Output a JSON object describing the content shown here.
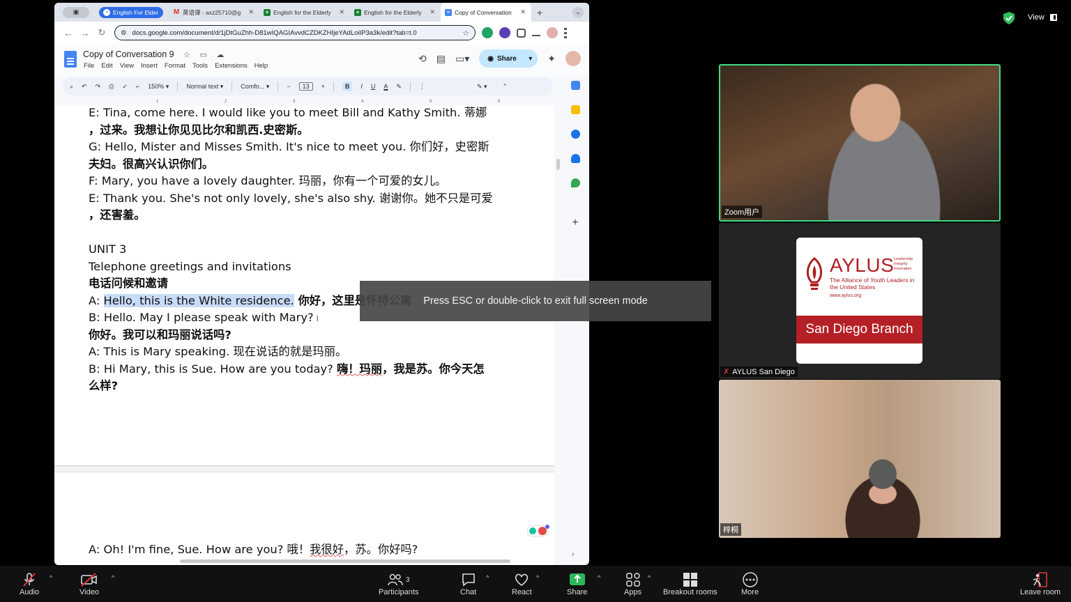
{
  "browser": {
    "tabs": [
      {
        "label": "English For Elder",
        "icon": "group-icon"
      },
      {
        "label": "英语课 - axz25710@g",
        "icon": "gmail-icon"
      },
      {
        "label": "English for the Elderly",
        "icon": "sheets-icon"
      },
      {
        "label": "English for the Elderly",
        "icon": "sheets-icon"
      },
      {
        "label": "Copy of Conversation",
        "icon": "docs-icon"
      }
    ],
    "url": "docs.google.com/document/d/1jDtGuZhh-D81wIQAGIAvvdCZDKZHIjeYAdLoiIP3a3k/edit?tab=t.0"
  },
  "doc": {
    "title": "Copy of Conversation 9",
    "menu": [
      "File",
      "Edit",
      "View",
      "Insert",
      "Format",
      "Tools",
      "Extensions",
      "Help"
    ],
    "share_label": "Share",
    "toolbar": {
      "zoom": "150%",
      "style": "Normal text",
      "font": "Comfo...",
      "size": "13",
      "bold": "B",
      "italic": "I",
      "underline": "U",
      "text_color": "A"
    },
    "ruler_ticks": [
      "1",
      "2",
      "3",
      "4",
      "5",
      "6"
    ],
    "lines": {
      "l1": "E: Tina, come here. I would like you to meet Bill and Kathy Smith. 蒂娜",
      "l2": "，过来。我想让你见见比尔和凯西.史密斯。",
      "l3": "G: Hello, Mister and Misses Smith. It's nice to meet you. 你们好，史密斯",
      "l4": "夫妇。很高兴认识你们。",
      "l5": "F: Mary, you have a lovely daughter. 玛丽，你有一个可爱的女儿。",
      "l6": "E: Thank you. She's not only lovely, she's also shy. 谢谢你。她不只是可爱",
      "l7": "，还害羞。",
      "l8": "UNIT 3",
      "l9": "Telephone greetings and invitations",
      "l10": "电话问候和邀请",
      "l11_prefix": "A: ",
      "l11_hl": "Hello, this is the White residence.",
      "l11_suffix": " 你好，这里是怀特公寓",
      "l12": "B: Hello. May I please speak with Mary?",
      "l13": "你好。我可以和玛丽说话吗?",
      "l14": "A: This is Mary speaking. 现在说话的就是玛丽。",
      "l15_a": "B: Hi Mary, this is Sue. How are you today? ",
      "l15_b": "嗨！玛丽",
      "l15_c": "，我是苏。你今天怎",
      "l16": "么样?",
      "p2_a": "A: Oh! I'm fine, Sue. How are you? 哦！",
      "p2_b": "我很好",
      "p2_c": "，苏。你好吗?"
    }
  },
  "toast": "Press ESC or double-click to exit full screen mode",
  "zoom": {
    "view_label": "View",
    "participants": [
      {
        "name": "Zoom用户"
      },
      {
        "name": "AYLUS San Diego"
      },
      {
        "name": "梓桐"
      }
    ],
    "aylus": {
      "title": "AYLUS",
      "tagline": "Leadership Integrity Innovation",
      "subtitle": "The Alliance of Youth Leaders in the United States",
      "url": "www.aylus.org",
      "branch": "San Diego Branch"
    },
    "toolbar": {
      "audio": "Audio",
      "video": "Video",
      "participants": "Participants",
      "participants_count": "3",
      "chat": "Chat",
      "react": "React",
      "share": "Share",
      "apps": "Apps",
      "breakout": "Breakout rooms",
      "more": "More",
      "leave": "Leave room"
    },
    "colors": {
      "active_speaker": "#3ddc84",
      "share_green": "#2fb55d",
      "muted_red": "#e0393e"
    }
  }
}
